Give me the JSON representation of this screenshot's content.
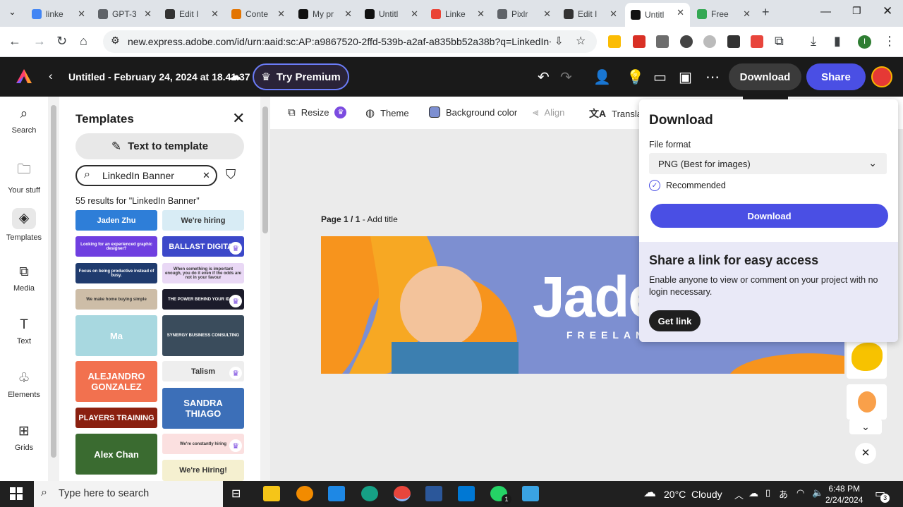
{
  "browser": {
    "tabs": [
      {
        "title": "linke",
        "color": "#4285f4"
      },
      {
        "title": "GPT-3",
        "color": "#5f6368"
      },
      {
        "title": "Edit I",
        "color": "#333333"
      },
      {
        "title": "Conte",
        "color": "#e37400"
      },
      {
        "title": "My pr",
        "color": "#111111"
      },
      {
        "title": "Untitl",
        "color": "#111111"
      },
      {
        "title": "Linke",
        "color": "#ea4335"
      },
      {
        "title": "Pixlr",
        "color": "#5f6368"
      },
      {
        "title": "Edit I",
        "color": "#333333"
      },
      {
        "title": "Untitl",
        "color": "#111111"
      },
      {
        "title": "Free",
        "color": "#34a853"
      }
    ],
    "url": "new.express.adobe.com/id/urn:aaid:sc:AP:a9867520-2ffd-539b-a2af-a835bb52a38b?q=LinkedIn+Bann..."
  },
  "app": {
    "doc_title": "Untitled - February 24, 2024 at 18.41.37",
    "try_premium": "Try Premium",
    "download": "Download",
    "share": "Share"
  },
  "rail": [
    {
      "label": "Search",
      "icon": "⌕"
    },
    {
      "label": "Your stuff",
      "icon": "🗀"
    },
    {
      "label": "Templates",
      "icon": "◈"
    },
    {
      "label": "Media",
      "icon": "⧉"
    },
    {
      "label": "Text",
      "icon": "T"
    },
    {
      "label": "Elements",
      "icon": "♧"
    },
    {
      "label": "Grids",
      "icon": "⊞"
    }
  ],
  "panel": {
    "title": "Templates",
    "text_to_template": "Text to template",
    "search_value": "LinkedIn Banner",
    "results": "55 results for \"LinkedIn Banner\"",
    "thumbs": [
      {
        "text": "Jaden Zhu",
        "bg": "#2e7ed8"
      },
      {
        "text": "We're hiring",
        "bg": "#d8ecf5"
      },
      {
        "text": "Looking for an experienced graphic designer?",
        "bg": "#6f3fe0"
      },
      {
        "text": "BALLAST DIGITAL",
        "bg": "#3c48c9"
      },
      {
        "text": "Focus on being productive instead of busy.",
        "bg": "#1f3b6e"
      },
      {
        "text": "When something is important enough, you do it even if the odds are not in your favour",
        "bg": "#e9d8f5"
      },
      {
        "text": "We make home buying simple",
        "bg": "#cdbda7"
      },
      {
        "text": "THE POWER BEHIND YOUR IDEAS",
        "bg": "#1c1c2b"
      },
      {
        "text": "Ma",
        "bg": "#a8d8e0"
      },
      {
        "text": "SYNERGY BUSINESS CONSULTING",
        "bg": "#3a4c5c"
      },
      {
        "text": "ALEJANDRO GONZALEZ",
        "bg": "#f2714f"
      },
      {
        "text": "Talism",
        "bg": "#eeeeee"
      },
      {
        "text": "PLAYERS TRAINING",
        "bg": "#8a2010"
      },
      {
        "text": "SANDRA THIAGO",
        "bg": "#3c6fb8"
      },
      {
        "text": "Alex Chan",
        "bg": "#3a6b30"
      },
      {
        "text": "We're constantly hiring",
        "bg": "#fbe0e0"
      },
      {
        "text": "We're Hiring!",
        "bg": "#f5f0d0"
      }
    ]
  },
  "toolbar": {
    "resize": "Resize",
    "theme": "Theme",
    "background_color": "Background color",
    "align": "Align",
    "translate": "Translate"
  },
  "canvas": {
    "page_label": "Page 1 / 1",
    "add_title": "Add title",
    "banner_name": "Jade",
    "banner_sub": "FREELAN"
  },
  "download_popover": {
    "title": "Download",
    "file_format_label": "File format",
    "file_format_value": "PNG (Best for images)",
    "recommended": "Recommended",
    "download_button": "Download",
    "share_title": "Share a link for easy access",
    "share_desc": "Enable anyone to view or comment on your project with no login necessary.",
    "get_link": "Get link"
  },
  "taskbar": {
    "search_placeholder": "Type here to search",
    "weather": "20°C  Cloudy",
    "time": "6:48 PM",
    "date": "2/24/2024",
    "notif_count": "3",
    "whatsapp_badge": "1"
  }
}
